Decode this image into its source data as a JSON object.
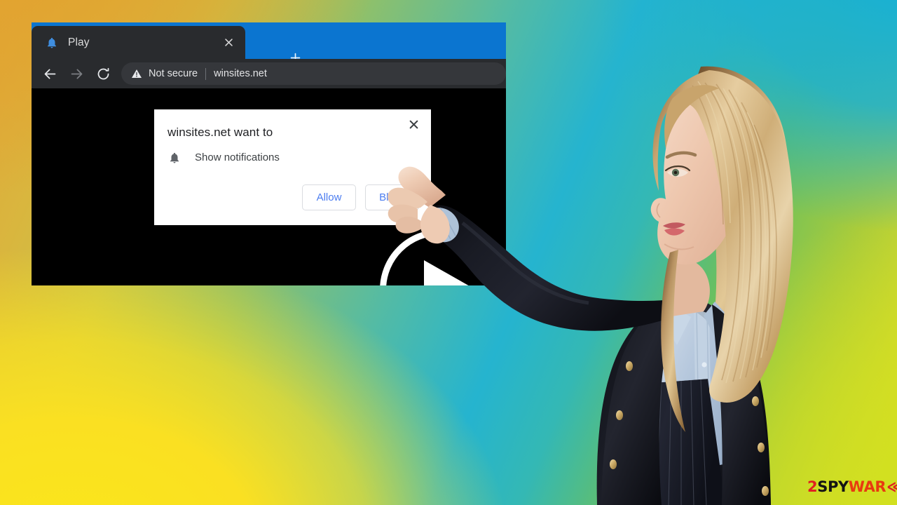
{
  "background": {
    "description": "colorful gradient backdrop",
    "colors": {
      "top_left": "#e0a83a",
      "top_right": "#14b0d8",
      "bottom_left": "#fbe61a",
      "bottom_right": "#cfe01f"
    }
  },
  "browser": {
    "tab": {
      "title": "Play",
      "favicon": "bell-icon",
      "close_label": "×"
    },
    "new_tab_label": "+",
    "toolbar": {
      "back_icon": "arrow-left-icon",
      "forward_icon": "arrow-right-icon",
      "reload_icon": "reload-icon",
      "security_icon": "warning-triangle-icon",
      "security_text": "Not secure",
      "url": "winsites.net"
    },
    "content": {
      "play_button": "play-icon",
      "background_color": "#000000"
    },
    "chrome_colors": {
      "tabstrip": "#0b75d0",
      "toolbar": "#292b2e",
      "omnibox": "#35373b"
    }
  },
  "permission_dialog": {
    "title": "winsites.net want to",
    "permission_icon": "bell-icon",
    "permission_label": "Show notifications",
    "close_label": "×",
    "buttons": [
      {
        "label": "Allow",
        "name": "allow-button"
      },
      {
        "label": "Block",
        "name": "block-button"
      }
    ],
    "accent_color": "#4c7df0"
  },
  "figure": {
    "description": "blonde woman in dark blazer pointing at the browser notification dialog",
    "blazer_color": "#15161d",
    "shirt_color": "#b4c6dc",
    "hair_color": "#d8b887"
  },
  "watermark": {
    "part1": "2",
    "part2": "SPY",
    "part3": "WAR",
    "part4": "≪",
    "color1": "#e02020",
    "color2": "#141414",
    "color3": "#e83a10"
  }
}
